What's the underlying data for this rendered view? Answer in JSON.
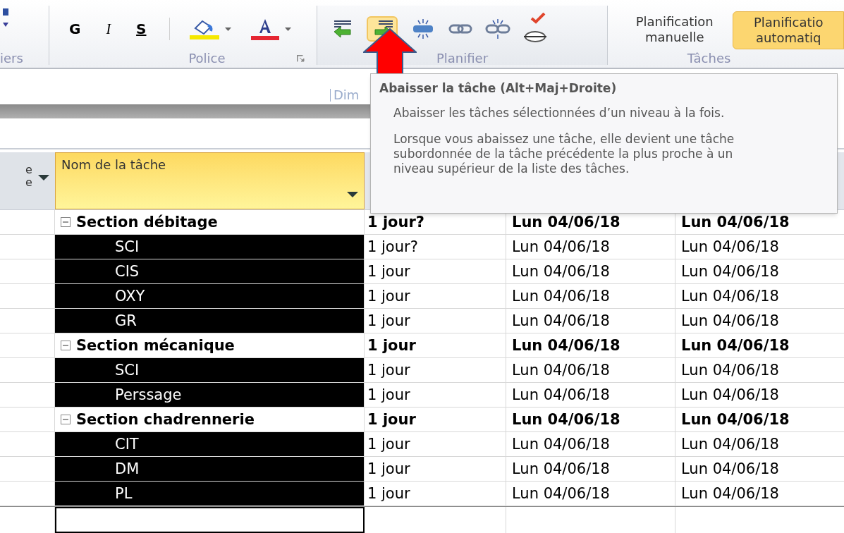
{
  "ribbon": {
    "groups": [
      {
        "kind": "cut",
        "label": "iers"
      },
      {
        "kind": "font",
        "label": "Police",
        "buttons": [
          "G",
          "I",
          "S"
        ]
      },
      {
        "kind": "schedule",
        "label": "Planifier",
        "indent_selected": true
      },
      {
        "kind": "tasks",
        "label": "Tâches",
        "buttons": [
          {
            "label": "Planification manuelle",
            "selected": false
          },
          {
            "label": "Planificatio automatiq",
            "selected": true
          }
        ]
      }
    ]
  },
  "timeline": {
    "date_label": "Dim"
  },
  "table": {
    "columns": [
      {
        "label": "e e",
        "selected": false
      },
      {
        "label": "Nom de la tâche",
        "selected": true
      }
    ],
    "rows": [
      {
        "kind": "summary",
        "name": "Section débitage",
        "duration": "1 jour?",
        "start": "Lun 04/06/18",
        "end": "Lun 04/06/18",
        "selected": false
      },
      {
        "kind": "task",
        "name": "SCI",
        "duration": "1 jour?",
        "start": "Lun 04/06/18",
        "end": "Lun 04/06/18",
        "selected": true
      },
      {
        "kind": "task",
        "name": "CIS",
        "duration": "1 jour",
        "start": "Lun 04/06/18",
        "end": "Lun 04/06/18",
        "selected": true
      },
      {
        "kind": "task",
        "name": "OXY",
        "duration": "1 jour",
        "start": "Lun 04/06/18",
        "end": "Lun 04/06/18",
        "selected": true
      },
      {
        "kind": "task",
        "name": "GR",
        "duration": "1 jour",
        "start": "Lun 04/06/18",
        "end": "Lun 04/06/18",
        "selected": true
      },
      {
        "kind": "summary",
        "name": "Section mécanique",
        "duration": "1 jour",
        "start": "Lun 04/06/18",
        "end": "Lun 04/06/18",
        "selected": false
      },
      {
        "kind": "task",
        "name": "SCI",
        "duration": "1 jour",
        "start": "Lun 04/06/18",
        "end": "Lun 04/06/18",
        "selected": true
      },
      {
        "kind": "task",
        "name": "Perssage",
        "duration": "1 jour",
        "start": "Lun 04/06/18",
        "end": "Lun 04/06/18",
        "selected": true
      },
      {
        "kind": "summary",
        "name": "Section chadrennerie",
        "duration": "1 jour",
        "start": "Lun 04/06/18",
        "end": "Lun 04/06/18",
        "selected": false
      },
      {
        "kind": "task",
        "name": "CIT",
        "duration": "1 jour",
        "start": "Lun 04/06/18",
        "end": "Lun 04/06/18",
        "selected": true
      },
      {
        "kind": "task",
        "name": "DM",
        "duration": "1 jour",
        "start": "Lun 04/06/18",
        "end": "Lun 04/06/18",
        "selected": true
      },
      {
        "kind": "task",
        "name": "PL",
        "duration": "1 jour",
        "start": "Lun 04/06/18",
        "end": "Lun 04/06/18",
        "selected": true
      }
    ]
  },
  "tooltip": {
    "title": "Abaisser la tâche (Alt+Maj+Droite)",
    "paragraphs": [
      "Abaisser les tâches sélectionnées d’un niveau à la fois.",
      "Lorsque vous abaissez une tâche, elle devient une tâche subordonnée de la tâche précédente la plus proche à un niveau supérieur de la liste des tâches."
    ]
  }
}
